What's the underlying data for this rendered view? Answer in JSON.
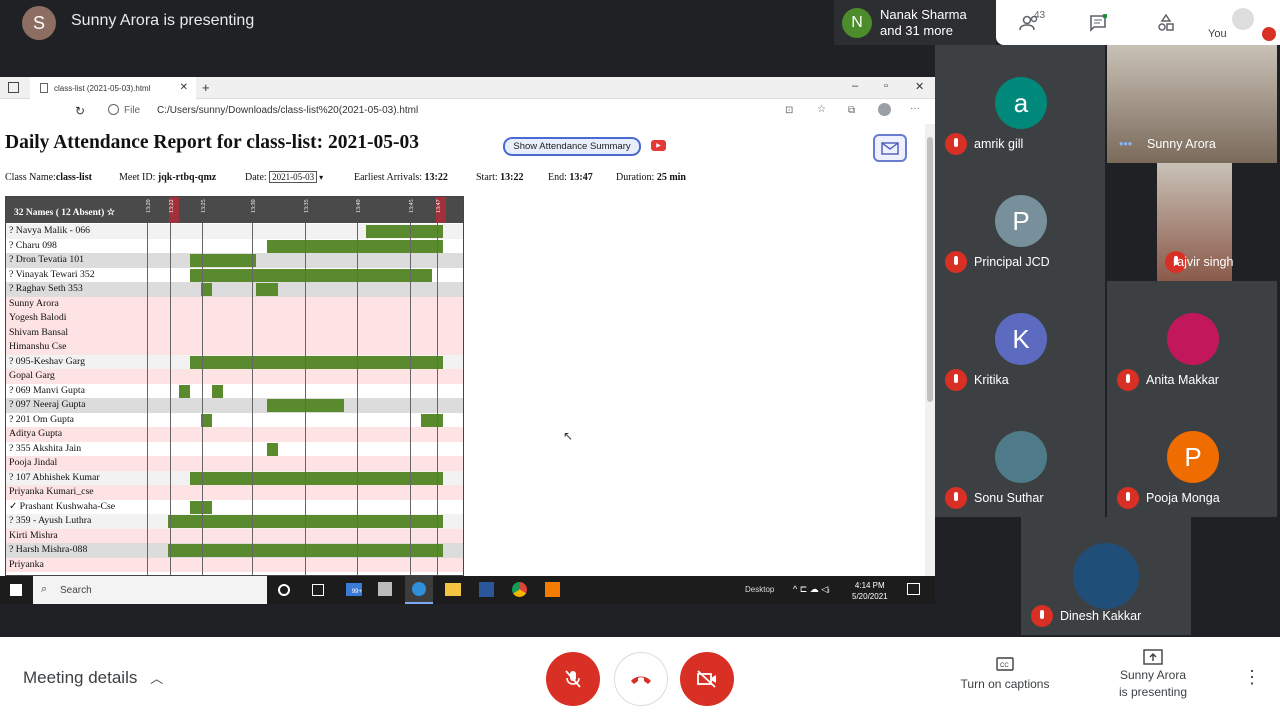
{
  "meeting": {
    "presenter_initial": "S",
    "presenter_title": "Sunny Arora is presenting",
    "participant_chip": {
      "initial": "N",
      "line1": "Nanak Sharma",
      "line2": "and 31 more"
    },
    "people_count": "43",
    "you_label": "You"
  },
  "browser": {
    "tab_title": "class-list (2021-05-03).html",
    "new_tab": "+",
    "file_label": "File",
    "url": "C:/Users/sunny/Downloads/class-list%20(2021-05-03).html"
  },
  "report": {
    "title": "Daily Attendance Report for class-list: 2021-05-03",
    "summary_button": "Show Attendance Summary",
    "class_label": "Class Name:",
    "class_value": "class-list",
    "meet_label": "Meet ID:",
    "meet_value": "jqk-rtbq-qmz",
    "date_label": "Date:",
    "date_value": "2021-05-03",
    "earliest_label": "Earliest Arrivals:",
    "earliest_value": "13:22",
    "start_label": "Start:",
    "start_value": "13:22",
    "end_label": "End:",
    "end_value": "13:47",
    "duration_label": "Duration:",
    "duration_value": "25 min",
    "table_header": "32 Names ( 12 Absent) ☆",
    "ticks": [
      "13:20",
      "13:22",
      "13:25",
      "13:30",
      "13:35",
      "13:40",
      "13:45",
      "13:47"
    ],
    "rows": [
      {
        "name": "? Navya Malik - 066",
        "bg": "#f2f2f2",
        "segs": [
          [
            13.4,
            13.47
          ]
        ]
      },
      {
        "name": "? Charu 098",
        "bg": "#ffffff",
        "segs": [
          [
            13.31,
            13.47
          ]
        ]
      },
      {
        "name": "? Dron Tevatia 101",
        "bg": "#dcdcdc",
        "segs": [
          [
            13.24,
            13.3
          ]
        ]
      },
      {
        "name": "? Vinayak Tewari 352",
        "bg": "#ffffff",
        "segs": [
          [
            13.24,
            13.46
          ]
        ]
      },
      {
        "name": "? Raghav Seth 353",
        "bg": "#dcdcdc",
        "segs": [
          [
            13.25,
            13.26
          ],
          [
            13.3,
            13.32
          ]
        ]
      },
      {
        "name": "Sunny Arora",
        "bg": "#fde3e3",
        "segs": []
      },
      {
        "name": "Yogesh Balodi",
        "bg": "#fde3e3",
        "segs": []
      },
      {
        "name": "Shivam Bansal",
        "bg": "#fde3e3",
        "segs": []
      },
      {
        "name": "Himanshu Cse",
        "bg": "#fde3e3",
        "segs": []
      },
      {
        "name": "? 095-Keshav Garg",
        "bg": "#f2f2f2",
        "segs": [
          [
            13.24,
            13.47
          ]
        ]
      },
      {
        "name": "Gopal Garg",
        "bg": "#fde3e3",
        "segs": []
      },
      {
        "name": "? 069 Manvi Gupta",
        "bg": "#ffffff",
        "segs": [
          [
            13.23,
            13.24
          ],
          [
            13.26,
            13.27
          ]
        ]
      },
      {
        "name": "? 097 Neeraj Gupta",
        "bg": "#dcdcdc",
        "segs": [
          [
            13.31,
            13.38
          ]
        ]
      },
      {
        "name": "? 201 Om Gupta",
        "bg": "#ffffff",
        "segs": [
          [
            13.25,
            13.26
          ],
          [
            13.45,
            13.47
          ]
        ]
      },
      {
        "name": "Aditya Gupta",
        "bg": "#fde3e3",
        "segs": []
      },
      {
        "name": "? 355 Akshita Jain",
        "bg": "#ffffff",
        "segs": [
          [
            13.31,
            13.32
          ]
        ]
      },
      {
        "name": "Pooja Jindal",
        "bg": "#fde3e3",
        "segs": []
      },
      {
        "name": "? 107 Abhishek Kumar",
        "bg": "#f2f2f2",
        "segs": [
          [
            13.24,
            13.47
          ]
        ]
      },
      {
        "name": "Priyanka Kumari_cse",
        "bg": "#fde3e3",
        "segs": []
      },
      {
        "name": "✓ Prashant Kushwaha-Cse",
        "bg": "#ffffff",
        "segs": [
          [
            13.24,
            13.26
          ]
        ]
      },
      {
        "name": "? 359 - Ayush Luthra",
        "bg": "#f2f2f2",
        "segs": [
          [
            13.22,
            13.47
          ]
        ]
      },
      {
        "name": "Kirti Mishra",
        "bg": "#fde3e3",
        "segs": []
      },
      {
        "name": "? Harsh Mishra-088",
        "bg": "#dcdcdc",
        "segs": [
          [
            13.22,
            13.47
          ]
        ]
      },
      {
        "name": "Priyanka",
        "bg": "#fde3e3",
        "segs": []
      }
    ]
  },
  "taskbar": {
    "search": "Search",
    "desktop": "Desktop",
    "time": "4:14 PM",
    "date": "5/20/2021",
    "badge": "99+"
  },
  "participants": [
    {
      "name": "amrik gill",
      "initial": "a",
      "color": "#00897b",
      "type": "avatar"
    },
    {
      "name": "Sunny Arora",
      "initial": "",
      "color": "#7a6a5a",
      "type": "video"
    },
    {
      "name": "Principal JCD",
      "initial": "P",
      "color": "#78909c",
      "type": "avatar"
    },
    {
      "name": "rajvir singh",
      "initial": "",
      "color": "#8a5a4a",
      "type": "video"
    },
    {
      "name": "Kritika",
      "initial": "K",
      "color": "#5c6bc0",
      "type": "avatar"
    },
    {
      "name": "Anita Makkar",
      "initial": "",
      "color": "#c2185b",
      "type": "photo"
    },
    {
      "name": "Sonu Suthar",
      "initial": "",
      "color": "#4e7a8a",
      "type": "photo"
    },
    {
      "name": "Pooja Monga",
      "initial": "P",
      "color": "#ef6c00",
      "type": "avatar"
    },
    {
      "name": "Dinesh Kakkar",
      "initial": "",
      "color": "#1f4e79",
      "type": "photo"
    }
  ],
  "bottom": {
    "meeting_details": "Meeting details",
    "captions": "Turn on captions",
    "presenting_line1": "Sunny Arora",
    "presenting_line2": "is presenting"
  },
  "colors": {
    "accent_red": "#d93025",
    "present_green": "#5a8a2e",
    "absent_pink": "#fde3e3"
  }
}
